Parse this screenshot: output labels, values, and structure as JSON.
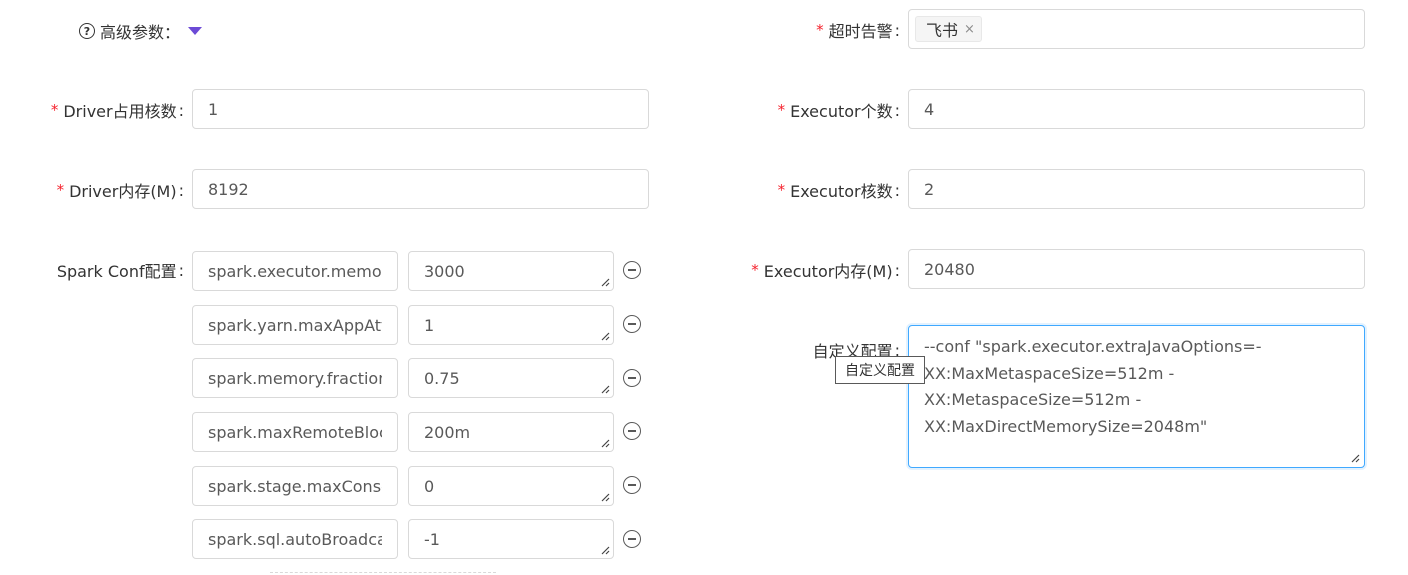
{
  "advanced": {
    "label": "高级参数："
  },
  "timeout_alert": {
    "label": "超时告警",
    "colon": ":",
    "tags": [
      "飞书"
    ],
    "close_glyph": "×"
  },
  "driver_cores": {
    "label": "Driver占用核数",
    "colon": ":",
    "value": "1"
  },
  "executor_count": {
    "label": "Executor个数",
    "colon": ":",
    "value": "4"
  },
  "driver_memory": {
    "label": "Driver内存(M)",
    "colon": ":",
    "value": "8192"
  },
  "executor_cores": {
    "label": "Executor核数",
    "colon": ":",
    "value": "2"
  },
  "spark_conf": {
    "label": "Spark Conf配置",
    "colon": ":",
    "rows": [
      {
        "key": "spark.executor.memory",
        "value": "3000"
      },
      {
        "key": "spark.yarn.maxAppAtte",
        "value": "1"
      },
      {
        "key": "spark.memory.fraction",
        "value": "0.75"
      },
      {
        "key": "spark.maxRemoteBlock",
        "value": "200m"
      },
      {
        "key": "spark.stage.maxConsec",
        "value": "0"
      },
      {
        "key": "spark.sql.autoBroadcas",
        "value": "-1"
      }
    ]
  },
  "executor_memory": {
    "label": "Executor内存(M)",
    "colon": ":",
    "value": "20480"
  },
  "custom_config": {
    "label": "自定义配置",
    "colon": ":",
    "lines": [
      "--conf \"spark.executor.extraJavaOptions=-",
      "XX:MaxMetaspaceSize=512m -",
      "XX:MetaspaceSize=512m -",
      "XX:MaxDirectMemorySize=2048m\""
    ],
    "tooltip": "自定义配置"
  },
  "colors": {
    "required": "#f5222d",
    "accent": "#6c4ad6",
    "focus_border": "#40a9ff",
    "border": "#d9d9d9"
  }
}
